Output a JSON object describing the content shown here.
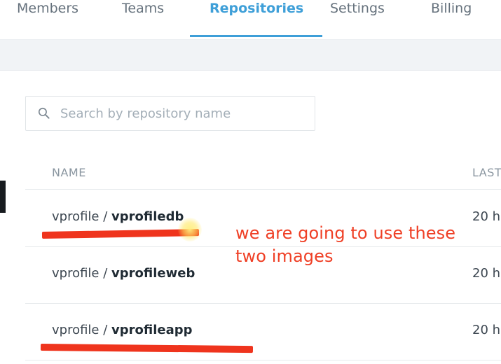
{
  "tabs": [
    {
      "label": "Members"
    },
    {
      "label": "Teams"
    },
    {
      "label": "Repositories",
      "active": true
    },
    {
      "label": "Settings"
    },
    {
      "label": "Billing"
    }
  ],
  "search": {
    "placeholder": "Search by repository name",
    "value": ""
  },
  "table": {
    "headers": {
      "name": "NAME",
      "last": "LAST"
    },
    "rows": [
      {
        "owner": "vprofile",
        "separator": " / ",
        "repo": "vprofiledb",
        "updated": "20 h"
      },
      {
        "owner": "vprofile",
        "separator": " / ",
        "repo": "vprofileweb",
        "updated": "20 h"
      },
      {
        "owner": "vprofile",
        "separator": " / ",
        "repo": "vprofileapp",
        "updated": "20 h"
      }
    ]
  },
  "annotation": {
    "line1": "we are going to use these",
    "line2": "two images"
  },
  "colors": {
    "accent": "#3e9fd8",
    "annotation_red": "#ef3f25",
    "border": "#e7eaed"
  },
  "icons": {
    "search": "search-icon"
  }
}
